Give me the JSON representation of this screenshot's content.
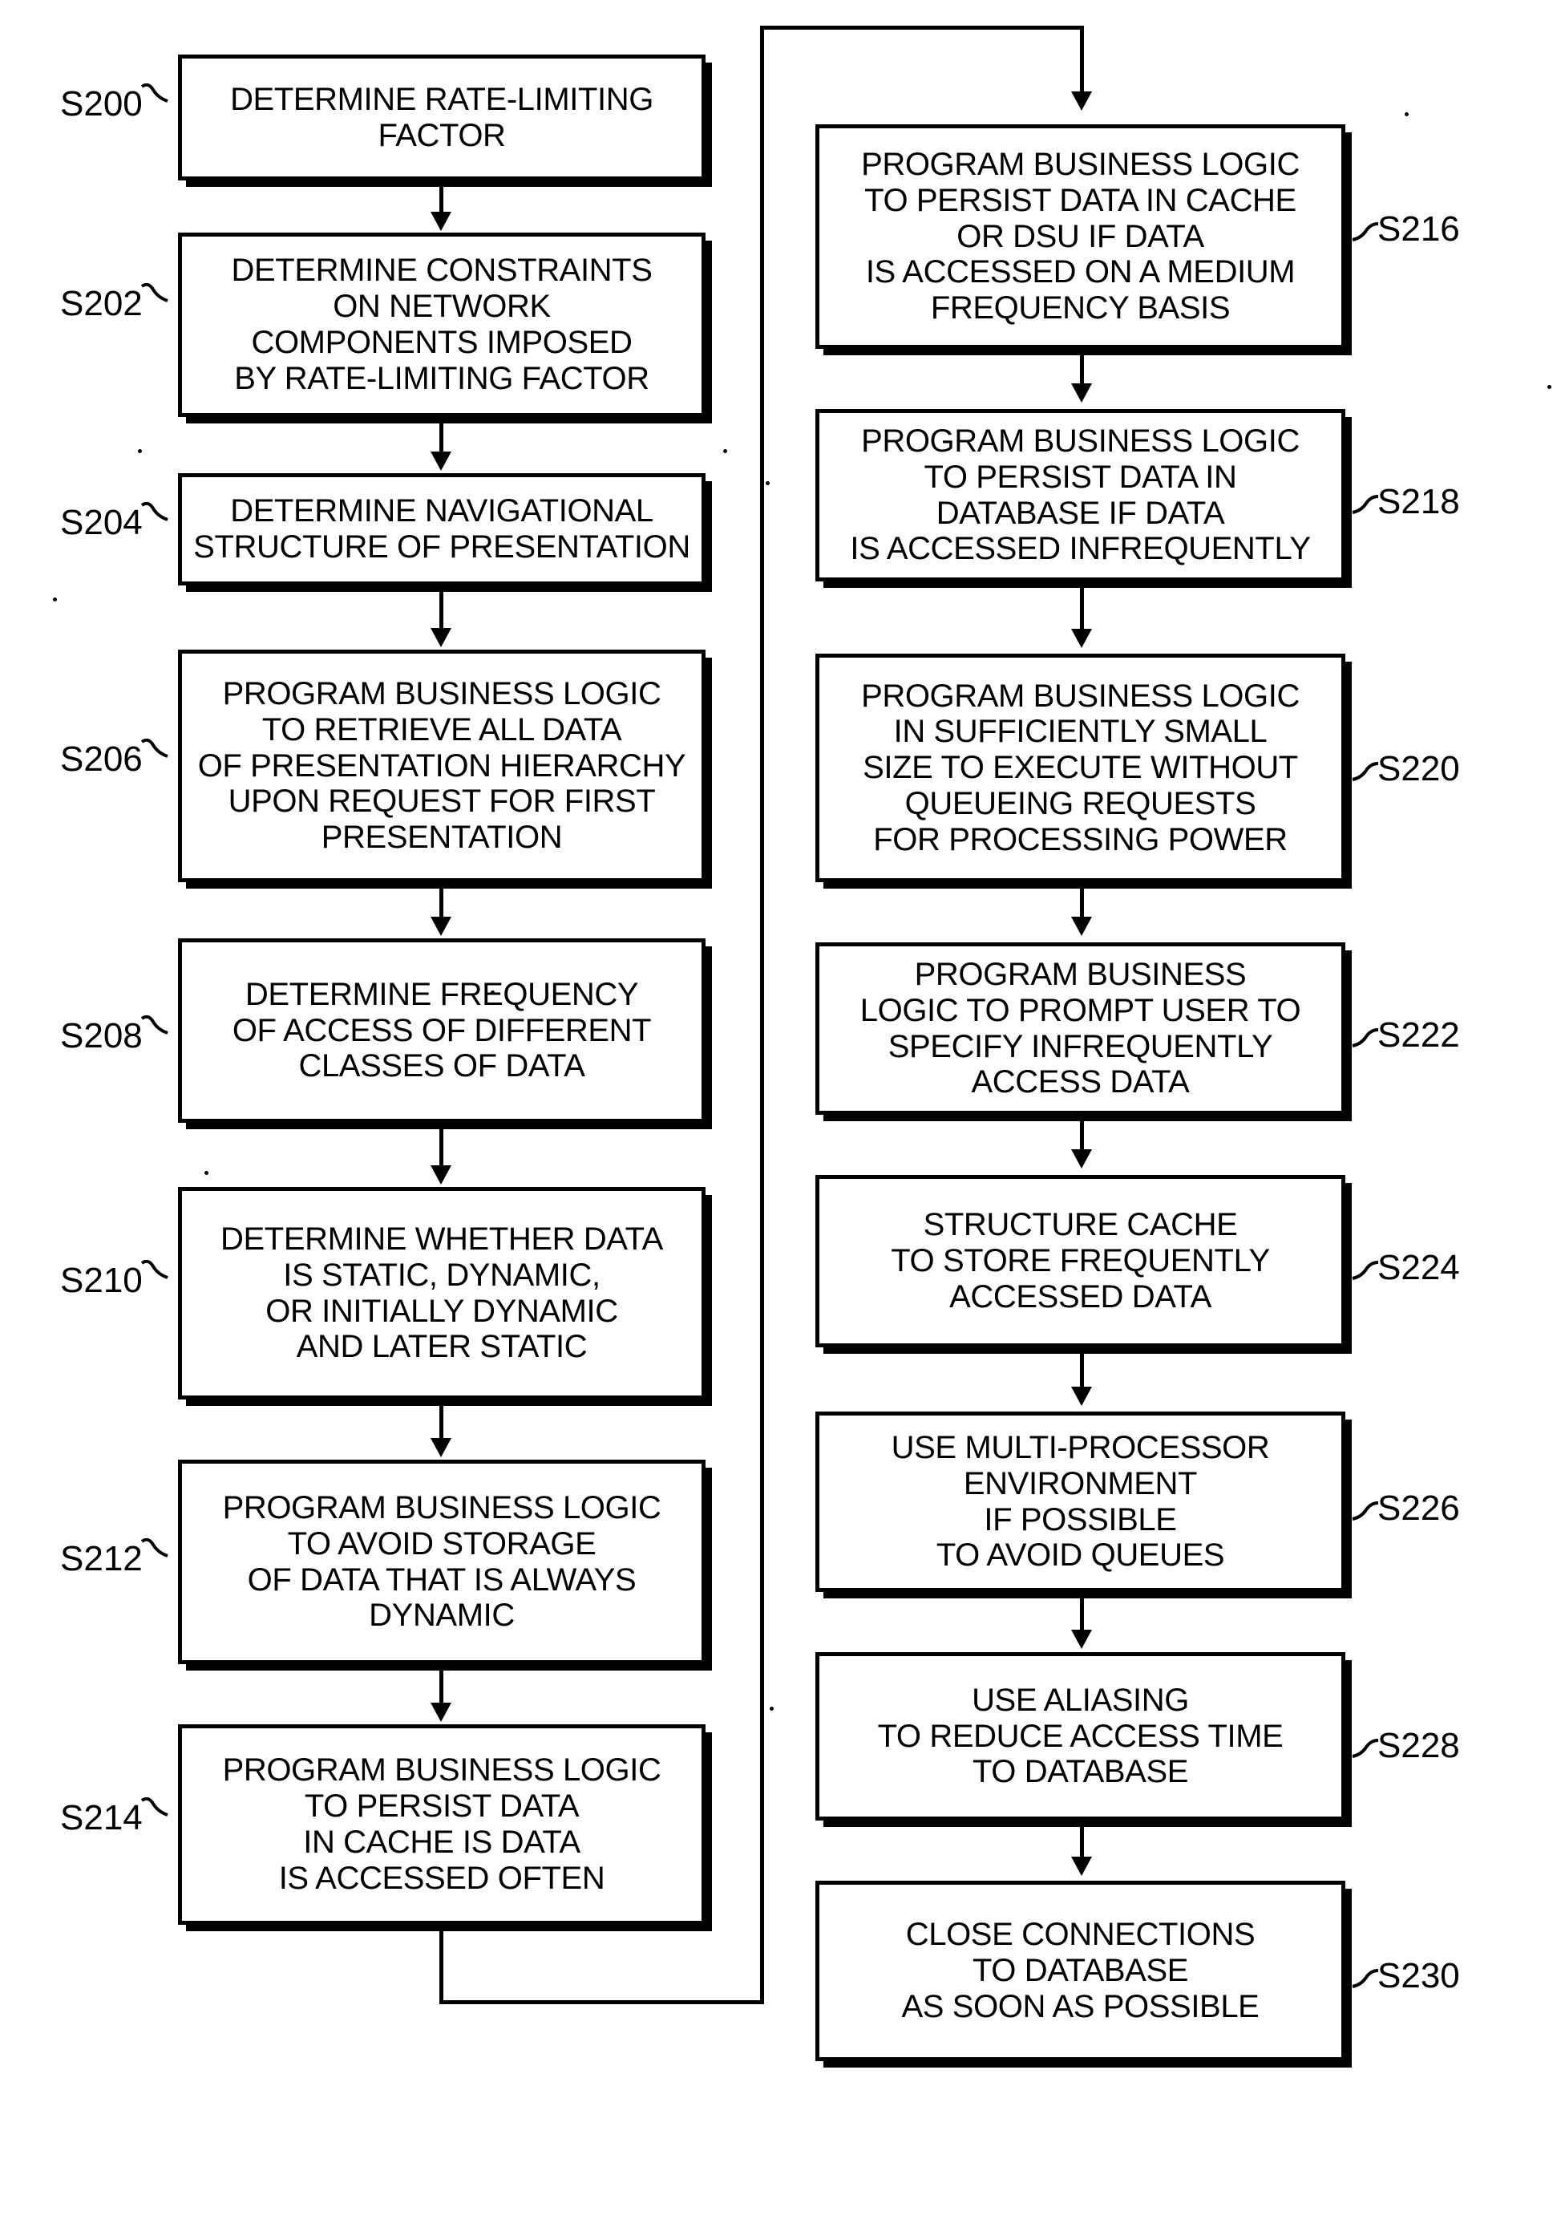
{
  "figure": {
    "type": "patent-flowchart",
    "orientation": "two-column",
    "background_color": "#ffffff",
    "line_color": "#000000"
  },
  "left_column": {
    "steps": [
      {
        "ref": "S200",
        "text": "DETERMINE RATE-LIMITING\nFACTOR",
        "label_side": "left"
      },
      {
        "ref": "S202",
        "text": "DETERMINE CONSTRAINTS\nON NETWORK\nCOMPONENTS IMPOSED\nBY RATE-LIMITING FACTOR",
        "label_side": "left"
      },
      {
        "ref": "S204",
        "text": "DETERMINE NAVIGATIONAL\nSTRUCTURE OF PRESENTATION",
        "label_side": "left"
      },
      {
        "ref": "S206",
        "text": "PROGRAM BUSINESS LOGIC\nTO RETRIEVE ALL DATA\nOF PRESENTATION HIERARCHY\nUPON REQUEST FOR FIRST\nPRESENTATION",
        "label_side": "left"
      },
      {
        "ref": "S208",
        "text": "DETERMINE FREQUENCY\nOF ACCESS OF DIFFERENT\nCLASSES OF DATA",
        "label_side": "left"
      },
      {
        "ref": "S210",
        "text": "DETERMINE WHETHER DATA\nIS STATIC, DYNAMIC,\nOR INITIALLY DYNAMIC\nAND LATER STATIC",
        "label_side": "left"
      },
      {
        "ref": "S212",
        "text": "PROGRAM BUSINESS LOGIC\nTO AVOID STORAGE\nOF DATA THAT IS ALWAYS\nDYNAMIC",
        "label_side": "left"
      },
      {
        "ref": "S214",
        "text": "PROGRAM BUSINESS LOGIC\nTO PERSIST DATA\nIN CACHE IS DATA\nIS ACCESSED OFTEN",
        "label_side": "left"
      }
    ]
  },
  "right_column": {
    "steps": [
      {
        "ref": "S216",
        "text": "PROGRAM BUSINESS LOGIC\nTO PERSIST DATA IN CACHE\nOR DSU IF DATA\nIS ACCESSED ON A MEDIUM\nFREQUENCY BASIS",
        "label_side": "right"
      },
      {
        "ref": "S218",
        "text": "PROGRAM BUSINESS LOGIC\nTO PERSIST DATA IN\nDATABASE IF DATA\nIS ACCESSED INFREQUENTLY",
        "label_side": "right"
      },
      {
        "ref": "S220",
        "text": "PROGRAM BUSINESS LOGIC\nIN SUFFICIENTLY SMALL\nSIZE TO EXECUTE WITHOUT\nQUEUEING REQUESTS\nFOR PROCESSING POWER",
        "label_side": "right"
      },
      {
        "ref": "S222",
        "text": "PROGRAM BUSINESS\nLOGIC TO PROMPT USER TO\nSPECIFY INFREQUENTLY\nACCESS DATA",
        "label_side": "right"
      },
      {
        "ref": "S224",
        "text": "STRUCTURE CACHE\nTO STORE FREQUENTLY\nACCESSED DATA",
        "label_side": "right"
      },
      {
        "ref": "S226",
        "text": "USE MULTI-PROCESSOR\nENVIRONMENT\nIF POSSIBLE\nTO AVOID QUEUES",
        "label_side": "right"
      },
      {
        "ref": "S228",
        "text": "USE ALIASING\nTO REDUCE ACCESS TIME\nTO DATABASE",
        "label_side": "right"
      },
      {
        "ref": "S230",
        "text": "CLOSE CONNECTIONS\nTO DATABASE\nAS SOON AS POSSIBLE",
        "label_side": "right"
      }
    ]
  },
  "flow": {
    "sequence": [
      "S200",
      "S202",
      "S204",
      "S206",
      "S208",
      "S210",
      "S212",
      "S214",
      "S216",
      "S218",
      "S220",
      "S222",
      "S224",
      "S226",
      "S228",
      "S230"
    ],
    "column_transition": {
      "from": "S214",
      "to": "S216",
      "routing": "down-right-up-right-down"
    }
  }
}
